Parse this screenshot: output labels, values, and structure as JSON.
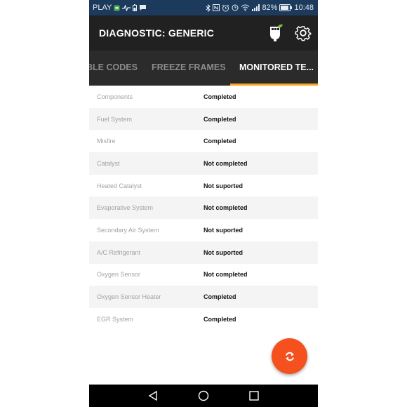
{
  "statusbar": {
    "carrier": "PLAY",
    "battery_percent": "82%",
    "time": "10:48",
    "left_icons": [
      "carrier-badge-icon",
      "heartbeat-icon",
      "battery-small-icon",
      "chat-bubble-icon"
    ],
    "right_icons": [
      "bluetooth-icon",
      "nfc-icon",
      "alarm-icon",
      "clock-icon",
      "wifi-icon",
      "signal-icon",
      "battery-icon"
    ]
  },
  "appbar": {
    "title": "DIAGNOSTIC: GENERIC",
    "icons": [
      "obd-dongle-icon",
      "gear-icon"
    ]
  },
  "tabs": [
    {
      "label": "BLE CODES",
      "active": false
    },
    {
      "label": "FREEZE FRAMES",
      "active": false
    },
    {
      "label": "MONITORED TE...",
      "active": true
    }
  ],
  "accent_color": "#f5a623",
  "fab_color": "#f4511e",
  "monitors": [
    {
      "name": "Components",
      "status": "Completed"
    },
    {
      "name": "Fuel System",
      "status": "Completed"
    },
    {
      "name": "Misfire",
      "status": "Completed"
    },
    {
      "name": "Catalyst",
      "status": "Not completed"
    },
    {
      "name": "Heated Catalyst",
      "status": "Not suported"
    },
    {
      "name": "Evaporative System",
      "status": "Not completed"
    },
    {
      "name": "Secondary Air System",
      "status": "Not suported"
    },
    {
      "name": "A/C Refrigerant",
      "status": "Not suported"
    },
    {
      "name": "Oxygen Sensor",
      "status": "Not completed"
    },
    {
      "name": "Oxygen Sensor Heater",
      "status": "Completed"
    },
    {
      "name": "EGR System",
      "status": "Completed"
    }
  ],
  "fab": {
    "icon": "refresh-icon"
  },
  "navbar": {
    "icons": [
      "back-icon",
      "home-icon",
      "recents-icon"
    ]
  }
}
